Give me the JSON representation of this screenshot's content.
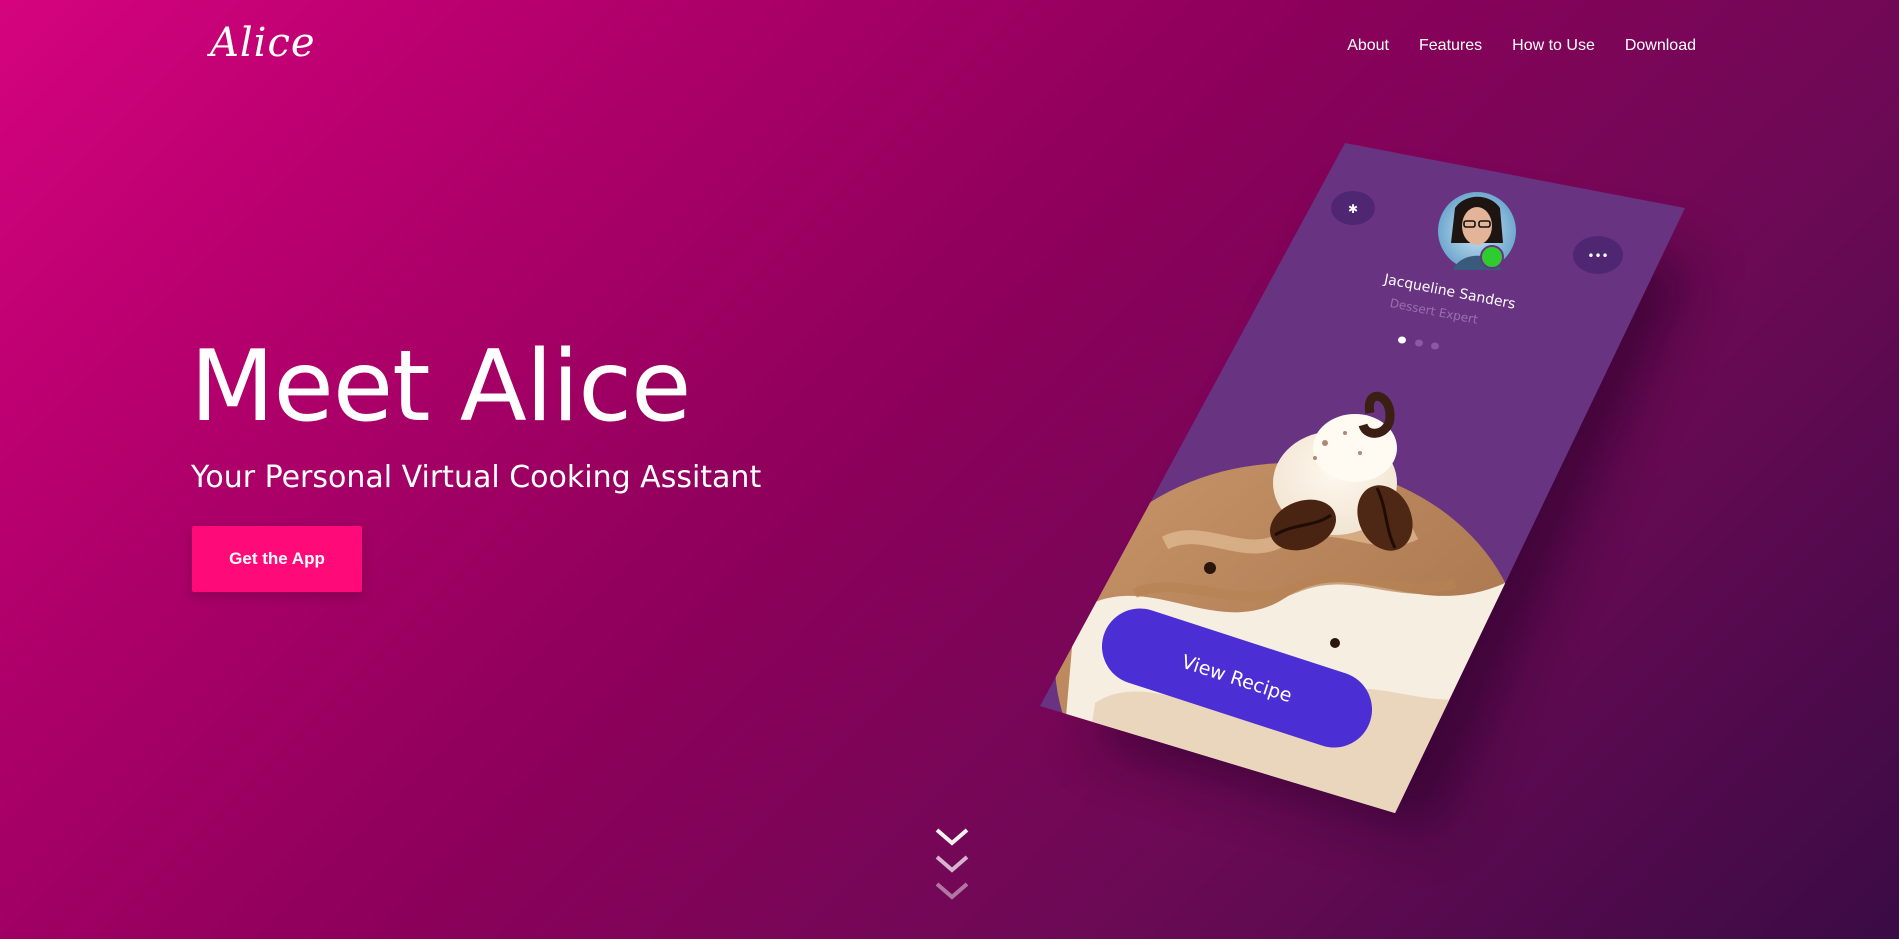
{
  "header": {
    "logo": "Alice",
    "nav": [
      "About",
      "Features",
      "How to Use",
      "Download"
    ]
  },
  "hero": {
    "title": "Meet Alice",
    "subtitle": "Your Personal Virtual Cooking Assitant",
    "cta_label": "Get the App"
  },
  "phone": {
    "profile_name": "Jacqueline Sanders",
    "profile_role": "Dessert Expert",
    "action_label": "View Recipe",
    "more_dots": "•••",
    "carousel_active_index": 0,
    "carousel_count": 3,
    "colors": {
      "screen": "#683381",
      "button": "#4b2ed4",
      "status_online": "#2ecc2e"
    },
    "icons": {
      "left": "settings-icon",
      "right": "more-icon"
    }
  },
  "colors": {
    "accent": "#ff0a78",
    "bg_start": "#d5037f",
    "bg_end": "#3a0b45"
  }
}
